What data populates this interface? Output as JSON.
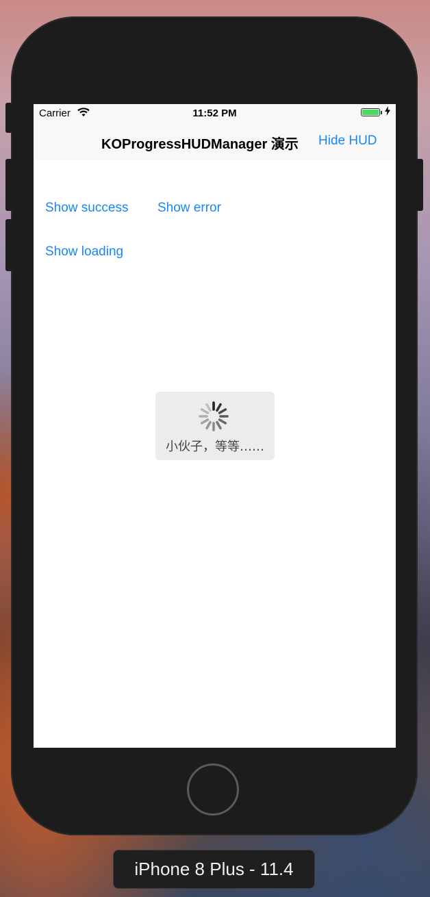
{
  "status_bar": {
    "carrier": "Carrier",
    "wifi_icon": "wifi-icon",
    "time": "11:52 PM",
    "battery_icon": "battery-icon",
    "charging_icon": "bolt-icon"
  },
  "nav_bar": {
    "title": "KOProgressHUDManager 演示",
    "right_button": "Hide HUD"
  },
  "buttons": {
    "show_success": "Show success",
    "show_error": "Show error",
    "show_loading": "Show loading"
  },
  "hud": {
    "spinner_icon": "activity-indicator-icon",
    "message": "小伙子，等等……"
  },
  "simulator": {
    "device_label": "iPhone 8 Plus - 11.4",
    "home_button_icon": "home-button-icon"
  },
  "colors": {
    "accent": "#1a86f0",
    "battery": "#4cd964",
    "hud_background": "#ececec",
    "device_body": "#1c1c1c"
  }
}
